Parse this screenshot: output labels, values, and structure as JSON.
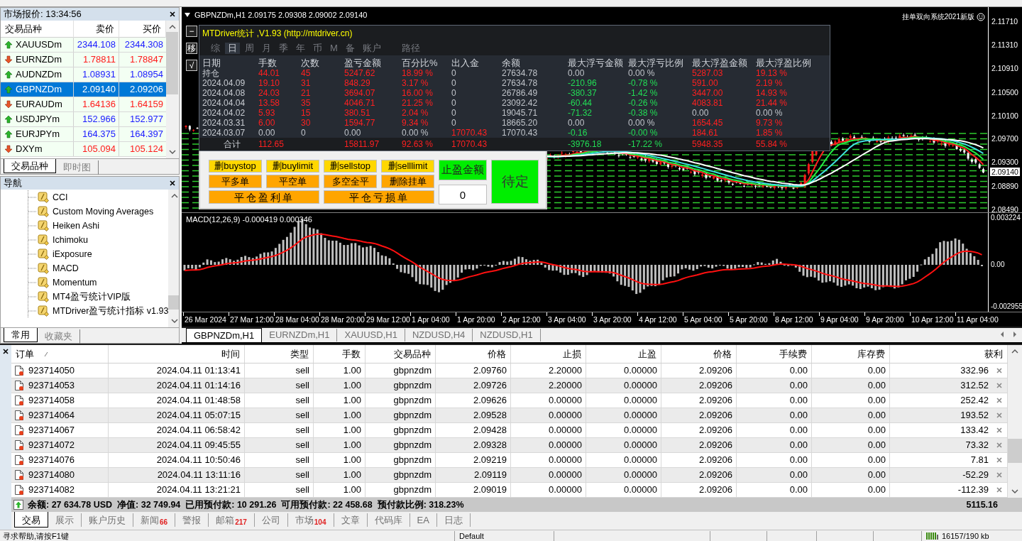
{
  "market_watch": {
    "title": "市场报价: 13:34:56",
    "columns": [
      "交易品种",
      "卖价",
      "买价"
    ],
    "rows": [
      {
        "symbol": "XAUUSDm",
        "bid": "2344.108",
        "ask": "2344.308",
        "rising": true,
        "selected": false
      },
      {
        "symbol": "EURNZDm",
        "bid": "1.78811",
        "ask": "1.78847",
        "rising": false,
        "selected": false
      },
      {
        "symbol": "AUDNZDm",
        "bid": "1.08931",
        "ask": "1.08954",
        "rising": true,
        "selected": false
      },
      {
        "symbol": "GBPNZDm",
        "bid": "2.09140",
        "ask": "2.09206",
        "rising": true,
        "selected": true
      },
      {
        "symbol": "EURAUDm",
        "bid": "1.64136",
        "ask": "1.64159",
        "rising": false,
        "selected": false
      },
      {
        "symbol": "USDJPYm",
        "bid": "152.966",
        "ask": "152.977",
        "rising": true,
        "selected": false
      },
      {
        "symbol": "EURJPYm",
        "bid": "164.375",
        "ask": "164.397",
        "rising": true,
        "selected": false
      },
      {
        "symbol": "DXYm",
        "bid": "105.094",
        "ask": "105.124",
        "rising": false,
        "selected": false
      }
    ],
    "tabs": [
      {
        "label": "交易品种",
        "selected": true
      },
      {
        "label": "即时图",
        "selected": false
      }
    ]
  },
  "navigator": {
    "title": "导航",
    "items": [
      "CCI",
      "Custom Moving Averages",
      "Heiken Ashi",
      "Ichimoku",
      "iExposure",
      "MACD",
      "Momentum",
      "MT4盈亏统计VIP版",
      "MTDriver盈亏统计指标 v1.93"
    ],
    "tabs": [
      {
        "label": "常用",
        "selected": true
      },
      {
        "label": "收藏夹",
        "selected": false
      }
    ]
  },
  "chart": {
    "title": "GBPNZDm,H1 2.09175 2.09308 2.09002 2.09140",
    "corner_label": "挂单双向系统2021新版",
    "side_buttons": [
      "−",
      "移",
      "√"
    ],
    "statistics": {
      "title": "MTDriver统计 ,V1.93 (http://mtdriver.cn)",
      "tabs": [
        {
          "label": "综",
          "selected": false
        },
        {
          "label": "日",
          "selected": true
        },
        {
          "label": "周",
          "selected": false
        },
        {
          "label": "月",
          "selected": false
        },
        {
          "label": "季",
          "selected": false
        },
        {
          "label": "年",
          "selected": false
        },
        {
          "label": "币",
          "selected": false
        },
        {
          "label": "M",
          "selected": false
        },
        {
          "label": "备",
          "selected": false
        },
        {
          "label": "账户",
          "selected": false
        },
        {
          "label": "路径",
          "selected": false
        }
      ],
      "label_column": "日期",
      "columns": [
        "手数",
        "次数",
        "盈亏金额",
        "百分比%",
        "出入金",
        "余额",
        "最大浮亏金额",
        "最大浮亏比例",
        "最大浮盈金额",
        "最大浮盈比例"
      ],
      "rows": [
        {
          "label": "持仓",
          "cells": [
            {
              "text": "44.01",
              "color": "#ff2020"
            },
            {
              "text": "45",
              "color": "#ff2020"
            },
            {
              "text": "5247.62",
              "color": "#ff2020"
            },
            {
              "text": "18.99 %",
              "color": "#ff2020"
            },
            {
              "text": "0",
              "color": "#c0c4ca"
            },
            {
              "text": "27634.78",
              "color": "#c0c4ca"
            },
            {
              "text": "0.00",
              "color": "#c0c4ca"
            },
            {
              "text": "0.00 %",
              "color": "#c0c4ca"
            },
            {
              "text": "5287.03",
              "color": "#ff2020"
            },
            {
              "text": "19.13 %",
              "color": "#ff2020"
            }
          ]
        },
        {
          "label": "2024.04.09",
          "cells": [
            {
              "text": "19.10",
              "color": "#ff2020"
            },
            {
              "text": "31",
              "color": "#ff2020"
            },
            {
              "text": "848.29",
              "color": "#ff2020"
            },
            {
              "text": "3.17 %",
              "color": "#ff2020"
            },
            {
              "text": "0",
              "color": "#c0c4ca"
            },
            {
              "text": "27634.78",
              "color": "#c0c4ca"
            },
            {
              "text": "-210.96",
              "color": "#22dd55"
            },
            {
              "text": "-0.78 %",
              "color": "#22dd55"
            },
            {
              "text": "591.00",
              "color": "#ff2020"
            },
            {
              "text": "2.19 %",
              "color": "#ff2020"
            }
          ]
        },
        {
          "label": "2024.04.08",
          "cells": [
            {
              "text": "24.03",
              "color": "#ff2020"
            },
            {
              "text": "21",
              "color": "#ff2020"
            },
            {
              "text": "3694.07",
              "color": "#ff2020"
            },
            {
              "text": "16.00 %",
              "color": "#ff2020"
            },
            {
              "text": "0",
              "color": "#c0c4ca"
            },
            {
              "text": "26786.49",
              "color": "#c0c4ca"
            },
            {
              "text": "-380.37",
              "color": "#22dd55"
            },
            {
              "text": "-1.42 %",
              "color": "#22dd55"
            },
            {
              "text": "3447.00",
              "color": "#ff2020"
            },
            {
              "text": "14.93 %",
              "color": "#ff2020"
            }
          ]
        },
        {
          "label": "2024.04.04",
          "cells": [
            {
              "text": "13.58",
              "color": "#ff2020"
            },
            {
              "text": "35",
              "color": "#ff2020"
            },
            {
              "text": "4046.71",
              "color": "#ff2020"
            },
            {
              "text": "21.25 %",
              "color": "#ff2020"
            },
            {
              "text": "0",
              "color": "#c0c4ca"
            },
            {
              "text": "23092.42",
              "color": "#c0c4ca"
            },
            {
              "text": "-60.44",
              "color": "#22dd55"
            },
            {
              "text": "-0.26 %",
              "color": "#22dd55"
            },
            {
              "text": "4083.81",
              "color": "#ff2020"
            },
            {
              "text": "21.44 %",
              "color": "#ff2020"
            }
          ]
        },
        {
          "label": "2024.04.02",
          "cells": [
            {
              "text": "5.93",
              "color": "#ff2020"
            },
            {
              "text": "15",
              "color": "#ff2020"
            },
            {
              "text": "380.51",
              "color": "#ff2020"
            },
            {
              "text": "2.04 %",
              "color": "#ff2020"
            },
            {
              "text": "0",
              "color": "#c0c4ca"
            },
            {
              "text": "19045.71",
              "color": "#c0c4ca"
            },
            {
              "text": "-71.32",
              "color": "#22dd55"
            },
            {
              "text": "-0.38 %",
              "color": "#22dd55"
            },
            {
              "text": "0.00",
              "color": "#c0c4ca"
            },
            {
              "text": "0.00 %",
              "color": "#c0c4ca"
            }
          ]
        },
        {
          "label": "2024.03.31",
          "cells": [
            {
              "text": "6.00",
              "color": "#ff2020"
            },
            {
              "text": "30",
              "color": "#ff2020"
            },
            {
              "text": "1594.77",
              "color": "#ff2020"
            },
            {
              "text": "9.34 %",
              "color": "#ff2020"
            },
            {
              "text": "0",
              "color": "#c0c4ca"
            },
            {
              "text": "18665.20",
              "color": "#c0c4ca"
            },
            {
              "text": "0.00",
              "color": "#c0c4ca"
            },
            {
              "text": "0.00 %",
              "color": "#c0c4ca"
            },
            {
              "text": "1654.45",
              "color": "#ff2020"
            },
            {
              "text": "9.73 %",
              "color": "#ff2020"
            }
          ]
        },
        {
          "label": "2024.03.07",
          "cells": [
            {
              "text": "0.00",
              "color": "#c0c4ca"
            },
            {
              "text": "0",
              "color": "#c0c4ca"
            },
            {
              "text": "0.00",
              "color": "#c0c4ca"
            },
            {
              "text": "0.00 %",
              "color": "#c0c4ca"
            },
            {
              "text": "17070.43",
              "color": "#ff2020"
            },
            {
              "text": "17070.43",
              "color": "#c0c4ca"
            },
            {
              "text": "-0.16",
              "color": "#22dd55"
            },
            {
              "text": "-0.00 %",
              "color": "#22dd55"
            },
            {
              "text": "184.61",
              "color": "#ff2020"
            },
            {
              "text": "1.85 %",
              "color": "#ff2020"
            }
          ]
        }
      ],
      "total": {
        "label": "合计",
        "cells": [
          {
            "text": "112.65",
            "color": "#ff2020"
          },
          null,
          {
            "text": "15811.97",
            "color": "#ff2020"
          },
          {
            "text": "92.63 %",
            "color": "#ff2020"
          },
          {
            "text": "17070.43",
            "color": "#ff2020"
          },
          null,
          {
            "text": "-3976.18",
            "color": "#22dd55"
          },
          {
            "text": "-17.22 %",
            "color": "#22dd55"
          },
          {
            "text": "5948.35",
            "color": "#ff2020"
          },
          {
            "text": "55.84 %",
            "color": "#ff2020"
          }
        ]
      }
    },
    "trade_panel": {
      "buttons": [
        {
          "label": "删buystop",
          "color": "#ffd700",
          "kind": "single"
        },
        {
          "label": "删buylimit",
          "color": "#ffd700",
          "kind": "single"
        },
        {
          "label": "删sellstop",
          "color": "#ffd700",
          "kind": "single"
        },
        {
          "label": "删selllimit",
          "color": "#ffd700",
          "kind": "single"
        },
        {
          "label": "平多单",
          "color": "#ffa500",
          "kind": "single"
        },
        {
          "label": "平空单",
          "color": "#ffa500",
          "kind": "single"
        },
        {
          "label": "多空全平",
          "color": "#ffa500",
          "kind": "single"
        },
        {
          "label": "删除挂单",
          "color": "#ffa500",
          "kind": "single"
        },
        {
          "label": "平仓盈利单",
          "color": "#ffa500",
          "kind": "wide"
        },
        {
          "label": "平仓亏损单",
          "color": "#ffa500",
          "kind": "wide"
        }
      ],
      "take_profit_label": "止盈金额",
      "take_profit_value": "0",
      "pending_button": "待定"
    },
    "price_axis": [
      {
        "label": "2.11710",
        "current": false
      },
      {
        "label": "2.11310",
        "current": false
      },
      {
        "label": "2.10910",
        "current": false
      },
      {
        "label": "2.10500",
        "current": false
      },
      {
        "label": "2.10100",
        "current": false
      },
      {
        "label": "2.09700",
        "current": false
      },
      {
        "label": "2.09300",
        "current": false
      },
      {
        "label": "2.09140",
        "current": true
      },
      {
        "label": "2.08890",
        "current": false
      },
      {
        "label": "2.08490",
        "current": false
      }
    ],
    "indicator_label": "MACD(12,26,9) -0.000419 0.000346",
    "indicator_axis": [
      "0.003224",
      "0.00",
      "-0.002955"
    ],
    "time_axis": [
      "26 Mar 2024",
      "27 Mar 12:00",
      "28 Mar 04:00",
      "28 Mar 20:00",
      "29 Mar 12:00",
      "1 Apr 04:00",
      "1 Apr 20:00",
      "2 Apr 12:00",
      "3 Apr 04:00",
      "3 Apr 20:00",
      "4 Apr 12:00",
      "5 Apr 04:00",
      "5 Apr 20:00",
      "8 Apr 12:00",
      "9 Apr 04:00",
      "9 Apr 20:00",
      "10 Apr 12:00",
      "11 Apr 04:00"
    ]
  },
  "chart_tabs": [
    {
      "label": "GBPNZDm,H1",
      "selected": true
    },
    {
      "label": "EURNZDm,H1",
      "selected": false
    },
    {
      "label": "XAUUSD,H1",
      "selected": false
    },
    {
      "label": "NZDUSD,H4",
      "selected": false
    },
    {
      "label": "NZDUSD,H1",
      "selected": false
    }
  ],
  "terminal": {
    "columns": [
      "订单",
      "时间",
      "类型",
      "手数",
      "交易品种",
      "价格",
      "止损",
      "止盈",
      "价格",
      "手续费",
      "库存费",
      "获利"
    ],
    "rows": [
      [
        "923714050",
        "2024.04.11 01:13:41",
        "sell",
        "1.00",
        "gbpnzdm",
        "2.09760",
        "2.20000",
        "0.00000",
        "2.09206",
        "0.00",
        "0.00",
        "332.96"
      ],
      [
        "923714053",
        "2024.04.11 01:14:16",
        "sell",
        "1.00",
        "gbpnzdm",
        "2.09726",
        "2.20000",
        "0.00000",
        "2.09206",
        "0.00",
        "0.00",
        "312.52"
      ],
      [
        "923714058",
        "2024.04.11 01:48:58",
        "sell",
        "1.00",
        "gbpnzdm",
        "2.09626",
        "0.00000",
        "0.00000",
        "2.09206",
        "0.00",
        "0.00",
        "252.42"
      ],
      [
        "923714064",
        "2024.04.11 05:07:15",
        "sell",
        "1.00",
        "gbpnzdm",
        "2.09528",
        "0.00000",
        "0.00000",
        "2.09206",
        "0.00",
        "0.00",
        "193.52"
      ],
      [
        "923714067",
        "2024.04.11 06:58:42",
        "sell",
        "1.00",
        "gbpnzdm",
        "2.09428",
        "0.00000",
        "0.00000",
        "2.09206",
        "0.00",
        "0.00",
        "133.42"
      ],
      [
        "923714072",
        "2024.04.11 09:45:55",
        "sell",
        "1.00",
        "gbpnzdm",
        "2.09328",
        "0.00000",
        "0.00000",
        "2.09206",
        "0.00",
        "0.00",
        "73.32"
      ],
      [
        "923714076",
        "2024.04.11 10:50:46",
        "sell",
        "1.00",
        "gbpnzdm",
        "2.09219",
        "0.00000",
        "0.00000",
        "2.09206",
        "0.00",
        "0.00",
        "7.81"
      ],
      [
        "923714080",
        "2024.04.11 13:11:16",
        "sell",
        "1.00",
        "gbpnzdm",
        "2.09119",
        "0.00000",
        "0.00000",
        "2.09206",
        "0.00",
        "0.00",
        "-52.29"
      ],
      [
        "923714082",
        "2024.04.11 13:21:21",
        "sell",
        "1.00",
        "gbpnzdm",
        "2.09019",
        "0.00000",
        "0.00000",
        "2.09206",
        "0.00",
        "0.00",
        "-112.39"
      ]
    ],
    "summary": "余额: 27 634.78 USD  净值: 32 749.94  已用预付款: 10 291.26  可用预付款: 22 458.68  预付款比例: 318.23%",
    "total_profit": "5115.16",
    "tabs": [
      {
        "label": "交易",
        "selected": true
      },
      {
        "label": "展示",
        "selected": false
      },
      {
        "label": "账户历史",
        "selected": false
      },
      {
        "label": "新闻",
        "count": "66",
        "selected": false
      },
      {
        "label": "警报",
        "selected": false
      },
      {
        "label": "邮箱",
        "count": "217",
        "selected": false
      },
      {
        "label": "公司",
        "selected": false
      },
      {
        "label": "市场",
        "count": "104",
        "selected": false
      },
      {
        "label": "文章",
        "selected": false
      },
      {
        "label": "代码库",
        "selected": false
      },
      {
        "label": "EA",
        "selected": false
      },
      {
        "label": "日志",
        "selected": false
      }
    ]
  },
  "status_bar": {
    "help": "寻求帮助,请按F1键",
    "profile": "Default",
    "traffic": "16157/190 kb"
  }
}
